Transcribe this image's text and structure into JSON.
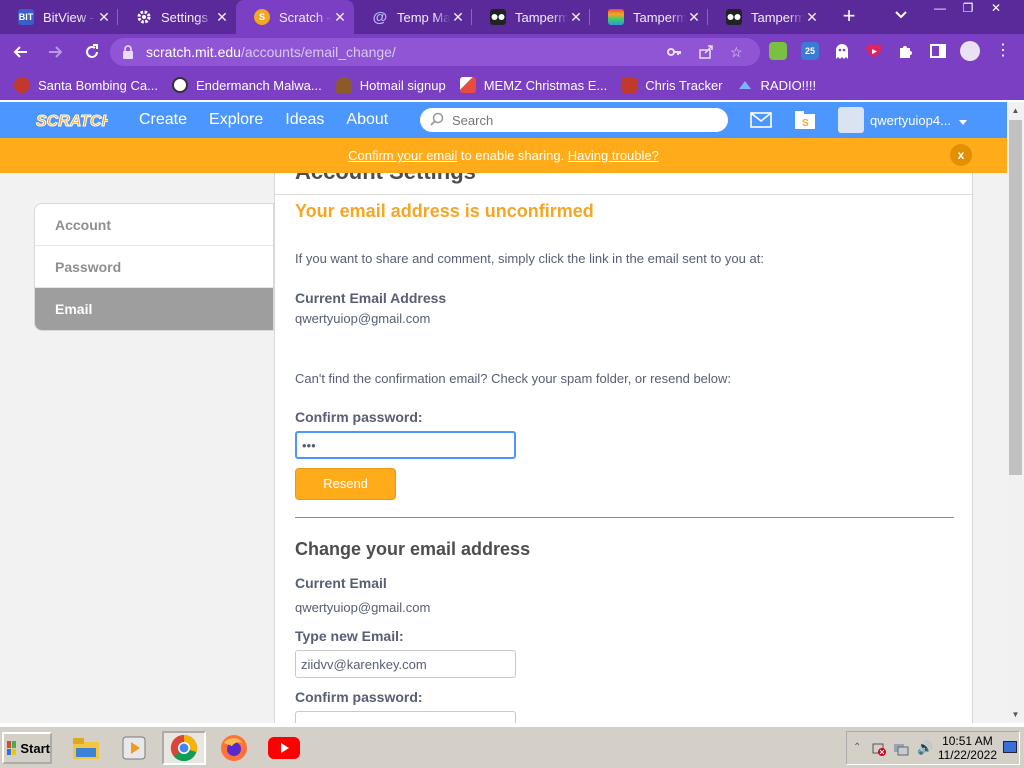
{
  "tabs": [
    {
      "title": "BitView -",
      "favicon_color": "#3b5fc4",
      "favicon_text": "BIT",
      "active": false
    },
    {
      "title": "Settings",
      "favicon_color": "#ffffff",
      "favicon_text": "",
      "active": false
    },
    {
      "title": "Scratch -",
      "favicon_color": "#f5a623",
      "favicon_text": "S",
      "active": true
    },
    {
      "title": "Temp Ma",
      "favicon_color": "#6b6bff",
      "favicon_text": "@",
      "active": false
    },
    {
      "title": "Tamperm",
      "favicon_color": "#222222",
      "favicon_text": "",
      "active": false
    },
    {
      "title": "Tamperm",
      "favicon_color": "#d94b4b",
      "favicon_text": "",
      "active": false
    },
    {
      "title": "Tamperm",
      "favicon_color": "#222222",
      "favicon_text": "",
      "active": false
    }
  ],
  "browser": {
    "url_host": "scratch.mit.edu",
    "url_path": "/accounts/email_change/"
  },
  "bookmarks": [
    {
      "label": "Santa Bombing Ca...",
      "color": "#c0392b"
    },
    {
      "label": "Endermanch Malwa...",
      "color": "#333333"
    },
    {
      "label": "Hotmail signup",
      "color": "#8b5a2b"
    },
    {
      "label": "MEMZ Christmas E...",
      "color": "#e74c3c"
    },
    {
      "label": "Chris Tracker",
      "color": "#c0392b"
    },
    {
      "label": "RADIO!!!!",
      "color": "#7fb3ff"
    }
  ],
  "scratch_nav": {
    "logo": "SCRATCH",
    "links": [
      "Create",
      "Explore",
      "Ideas",
      "About"
    ],
    "search_placeholder": "Search",
    "username": "qwertyuiop4..."
  },
  "banner": {
    "link1": "Confirm your email",
    "middle": " to enable sharing. ",
    "link2": "Having trouble?",
    "close": "x"
  },
  "sidebar": {
    "items": [
      {
        "label": "Account",
        "selected": false
      },
      {
        "label": "Password",
        "selected": false
      },
      {
        "label": "Email",
        "selected": true
      }
    ]
  },
  "settings": {
    "heading": "Account Settings",
    "unconfirmed_title": "Your email address is unconfirmed",
    "info_text": "If you want to share and comment, simply click the link in the email sent to you at:",
    "current_email_label": "Current Email Address",
    "current_email_value": "qwertyuiop@gmail.com",
    "spam_text": "Can't find the confirmation email? Check your spam folder, or resend below:",
    "confirm_password_label": "Confirm password:",
    "confirm_password_value": "•••",
    "resend_button": "Resend",
    "change_heading": "Change your email address",
    "current_email_label2": "Current Email",
    "current_email_value2": "qwertyuiop@gmail.com",
    "new_email_label": "Type new Email:",
    "new_email_value": "ziidvv@karenkey.com",
    "confirm_password_label2": "Confirm password:"
  },
  "taskbar": {
    "start": "Start",
    "time": "10:51 AM",
    "date": "11/22/2022"
  }
}
